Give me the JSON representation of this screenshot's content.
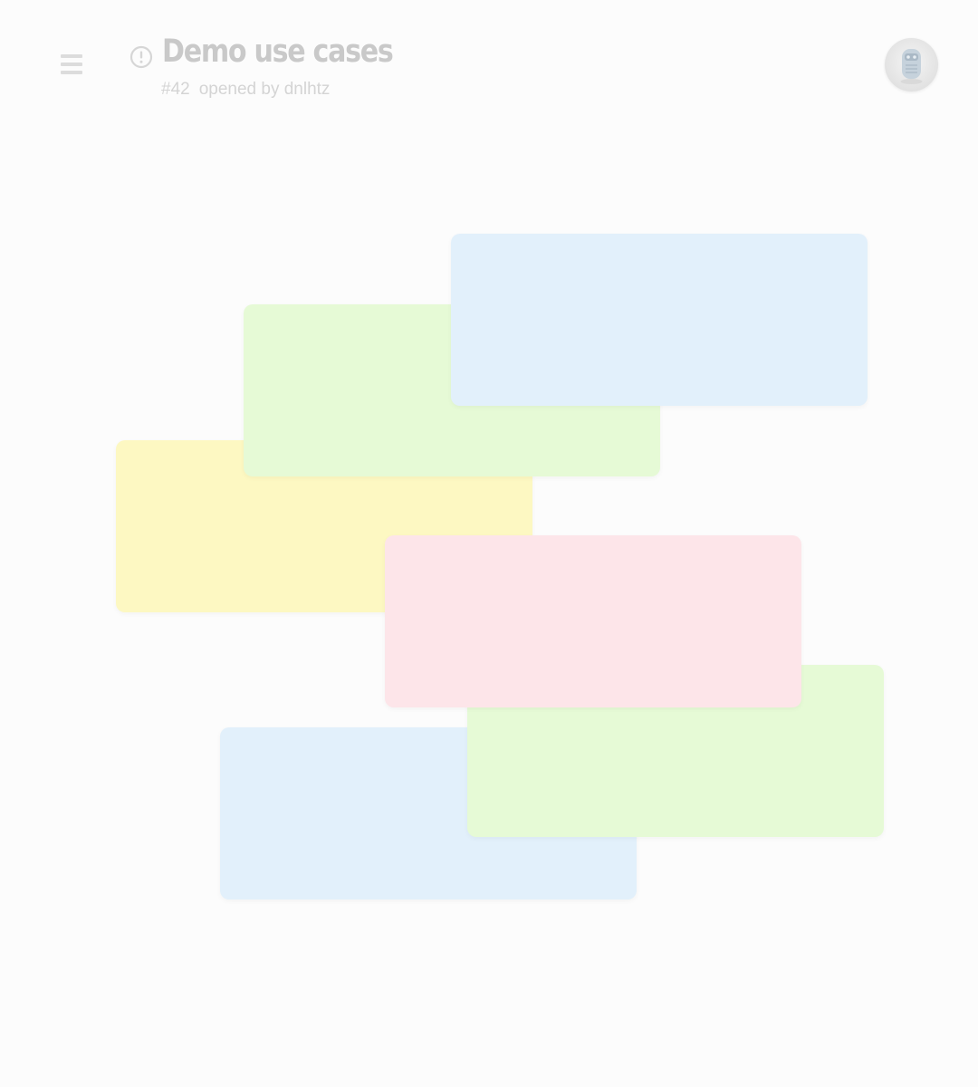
{
  "header": {
    "menu_icon": "hamburger-menu-icon",
    "status_icon": "issue-open-icon",
    "title": "Demo use cases",
    "issue_number": "#42",
    "opened_by": "opened by dnlhtz",
    "avatar_icon": "robot-avatar"
  },
  "cards": [
    {
      "color": "#fdf8c2"
    },
    {
      "color": "#e6fad6"
    },
    {
      "color": "#e2f0fb"
    },
    {
      "color": "#e2f0fb"
    },
    {
      "color": "#e6fad6"
    },
    {
      "color": "#fde5e9"
    }
  ]
}
